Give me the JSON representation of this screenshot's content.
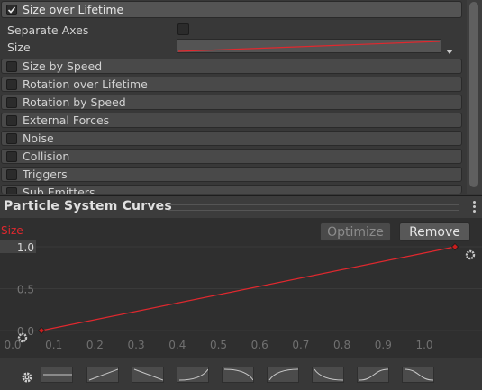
{
  "modules": {
    "size_over_lifetime": {
      "label": "Size over Lifetime",
      "checked": true
    },
    "separate_axes_label": "Separate Axes",
    "size_label": "Size",
    "items": [
      {
        "label": "Size by Speed"
      },
      {
        "label": "Rotation over Lifetime"
      },
      {
        "label": "Rotation by Speed"
      },
      {
        "label": "External Forces"
      },
      {
        "label": "Noise"
      },
      {
        "label": "Collision"
      },
      {
        "label": "Triggers"
      },
      {
        "label": "Sub Emitters"
      }
    ]
  },
  "curves_panel": {
    "title": "Particle System Curves",
    "optimize_label": "Optimize",
    "remove_label": "Remove",
    "curve_name": "Size",
    "y_ticks": [
      "1.0",
      "0.5",
      "0.0"
    ],
    "x_ticks": [
      "0.0",
      "0.1",
      "0.2",
      "0.3",
      "0.4",
      "0.5",
      "0.6",
      "0.7",
      "0.8",
      "0.9",
      "1.0"
    ],
    "keys": [
      {
        "time": 0.0,
        "value": 0.0
      },
      {
        "time": 1.0,
        "value": 1.0
      }
    ]
  },
  "colors": {
    "curve": "#e0282e",
    "background": "#383838",
    "accent": "#c81e1e"
  },
  "presets": [
    "flat",
    "linear-up",
    "linear-down",
    "ease-in",
    "ease-in-down",
    "ease-out",
    "ease-out-down",
    "s-curve-up",
    "s-curve-down"
  ]
}
